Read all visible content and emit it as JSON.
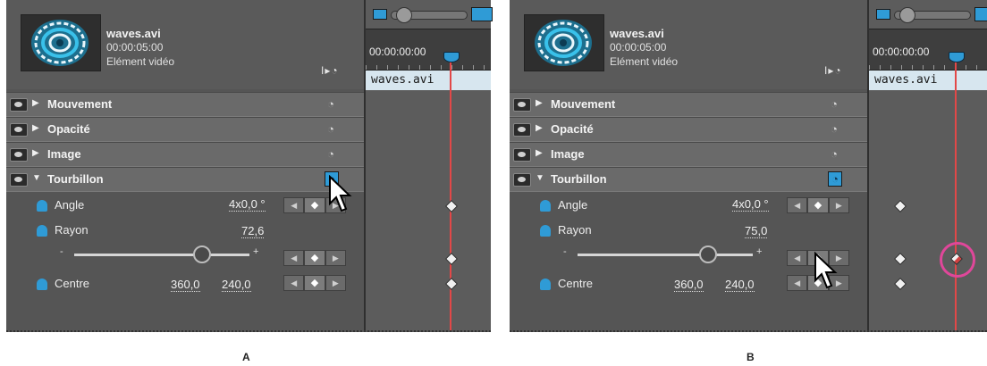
{
  "panels": [
    {
      "id": "A",
      "clip": {
        "title": "waves.avi",
        "duration": "00:00:05:00",
        "type": "Elément vidéo"
      },
      "header_icons": "I▸◔",
      "properties": [
        {
          "label": "Mouvement",
          "expanded": false
        },
        {
          "label": "Opacité",
          "expanded": false
        },
        {
          "label": "Image",
          "expanded": false
        },
        {
          "label": "Tourbillon",
          "expanded": true,
          "stopwatch_active": true
        }
      ],
      "params": {
        "angle": {
          "label": "Angle",
          "value": "4x0,0 °"
        },
        "rayon": {
          "label": "Rayon",
          "value": "72,6"
        },
        "slider": {
          "min_label": "-",
          "max_label": "+",
          "position": 0.72
        },
        "centre": {
          "label": "Centre",
          "x": "360,0",
          "y": "240,0"
        }
      },
      "timeline": {
        "timecode": "00:00:00:00",
        "clip_label": "waves.avi"
      }
    },
    {
      "id": "B",
      "clip": {
        "title": "waves.avi",
        "duration": "00:00:05:00",
        "type": "Elément vidéo"
      },
      "header_icons": "I▸◔",
      "properties": [
        {
          "label": "Mouvement",
          "expanded": false
        },
        {
          "label": "Opacité",
          "expanded": false
        },
        {
          "label": "Image",
          "expanded": false
        },
        {
          "label": "Tourbillon",
          "expanded": true,
          "stopwatch_active": true
        }
      ],
      "params": {
        "angle": {
          "label": "Angle",
          "value": "4x0,0 °"
        },
        "rayon": {
          "label": "Rayon",
          "value": "75,0"
        },
        "slider": {
          "min_label": "-",
          "max_label": "+",
          "position": 0.74
        },
        "centre": {
          "label": "Centre",
          "x": "360,0",
          "y": "240,0"
        }
      },
      "timeline": {
        "timecode": "00:00:00:00",
        "clip_label": "waves.avi"
      }
    }
  ],
  "captions": {
    "a": "A",
    "b": "B"
  },
  "colors": {
    "accent": "#2f9bd6",
    "playhead": "#e24848",
    "highlight_ring": "#e0479a"
  }
}
